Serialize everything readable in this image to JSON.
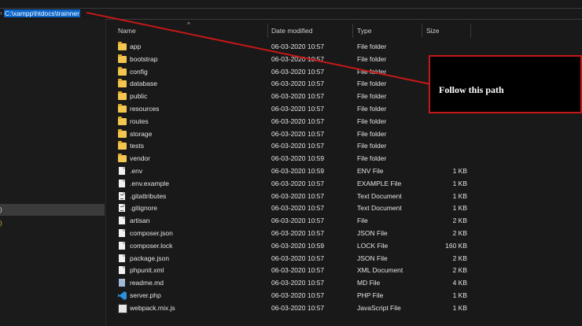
{
  "address_bar": {
    "path": "C:\\xampp\\htdocs\\trainner"
  },
  "columns": {
    "name": "Name",
    "date": "Date modified",
    "type": "Type",
    "size": "Size"
  },
  "sidebar": {
    "mark_a": ")",
    "mark_b": ")"
  },
  "files": [
    {
      "name": "app",
      "date": "06-03-2020 10:57",
      "type": "File folder",
      "size": "",
      "icon": "folder"
    },
    {
      "name": "bootstrap",
      "date": "06-03-2020 10:57",
      "type": "File folder",
      "size": "",
      "icon": "folder"
    },
    {
      "name": "config",
      "date": "06-03-2020 10:57",
      "type": "File folder",
      "size": "",
      "icon": "folder"
    },
    {
      "name": "database",
      "date": "06-03-2020 10:57",
      "type": "File folder",
      "size": "",
      "icon": "folder"
    },
    {
      "name": "public",
      "date": "06-03-2020 10:57",
      "type": "File folder",
      "size": "",
      "icon": "folder"
    },
    {
      "name": "resources",
      "date": "06-03-2020 10:57",
      "type": "File folder",
      "size": "",
      "icon": "folder"
    },
    {
      "name": "routes",
      "date": "06-03-2020 10:57",
      "type": "File folder",
      "size": "",
      "icon": "folder"
    },
    {
      "name": "storage",
      "date": "06-03-2020 10:57",
      "type": "File folder",
      "size": "",
      "icon": "folder"
    },
    {
      "name": "tests",
      "date": "06-03-2020 10:57",
      "type": "File folder",
      "size": "",
      "icon": "folder"
    },
    {
      "name": "vendor",
      "date": "06-03-2020 10:59",
      "type": "File folder",
      "size": "",
      "icon": "folder"
    },
    {
      "name": ".env",
      "date": "06-03-2020 10:59",
      "type": "ENV File",
      "size": "1 KB",
      "icon": "file"
    },
    {
      "name": ".env.example",
      "date": "06-03-2020 10:57",
      "type": "EXAMPLE File",
      "size": "1 KB",
      "icon": "file"
    },
    {
      "name": ".gitattributes",
      "date": "06-03-2020 10:57",
      "type": "Text Document",
      "size": "1 KB",
      "icon": "text"
    },
    {
      "name": ".gitignore",
      "date": "06-03-2020 10:57",
      "type": "Text Document",
      "size": "1 KB",
      "icon": "text"
    },
    {
      "name": "artisan",
      "date": "06-03-2020 10:57",
      "type": "File",
      "size": "2 KB",
      "icon": "file"
    },
    {
      "name": "composer.json",
      "date": "06-03-2020 10:57",
      "type": "JSON File",
      "size": "2 KB",
      "icon": "file"
    },
    {
      "name": "composer.lock",
      "date": "06-03-2020 10:59",
      "type": "LOCK File",
      "size": "160 KB",
      "icon": "file"
    },
    {
      "name": "package.json",
      "date": "06-03-2020 10:57",
      "type": "JSON File",
      "size": "2 KB",
      "icon": "file"
    },
    {
      "name": "phpunit.xml",
      "date": "06-03-2020 10:57",
      "type": "XML Document",
      "size": "2 KB",
      "icon": "file"
    },
    {
      "name": "readme.md",
      "date": "06-03-2020 10:57",
      "type": "MD File",
      "size": "4 KB",
      "icon": "markdown"
    },
    {
      "name": "server.php",
      "date": "06-03-2020 10:57",
      "type": "PHP File",
      "size": "1 KB",
      "icon": "vscode"
    },
    {
      "name": "webpack.mix.js",
      "date": "06-03-2020 10:57",
      "type": "JavaScript File",
      "size": "1 KB",
      "icon": "javascript"
    }
  ],
  "annotation": {
    "text": "Follow this path",
    "color": "#c41818"
  },
  "colors": {
    "folder": "#f3c64f",
    "selection": "#0a64c8",
    "background": "#191919"
  }
}
